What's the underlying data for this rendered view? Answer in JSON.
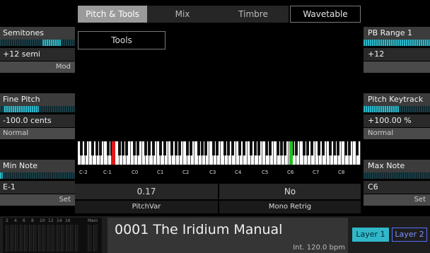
{
  "tabs": [
    {
      "label": "Pitch & Tools",
      "active": true
    },
    {
      "label": "Mix",
      "active": false
    },
    {
      "label": "Timbre",
      "active": false
    },
    {
      "label": "Wavetable",
      "active": false
    }
  ],
  "tools": {
    "label": "Tools"
  },
  "left": {
    "semitones": {
      "header": "Semitones",
      "value": "+12 semi",
      "mode": "Mod",
      "level": 0.8
    },
    "fine_pitch": {
      "header": "Fine Pitch",
      "value": "-100.0 cents",
      "mode": "Normal",
      "level": 0.5
    },
    "min_note": {
      "header": "Min Note",
      "value": "E-1",
      "mode": "Set",
      "level": 0.05
    }
  },
  "right": {
    "pb_range": {
      "header": "PB Range 1",
      "value": "+12",
      "level": 1.0
    },
    "pitch_keytrack": {
      "header": "Pitch Keytrack",
      "value": "+100.00 %",
      "mode": "Normal",
      "level": 0.5
    },
    "max_note": {
      "header": "Max Note",
      "value": "C6",
      "mode": "Set",
      "level": 0.0
    }
  },
  "keyboard": {
    "octave_labels": [
      "C-2",
      "C-1",
      "C0",
      "C1",
      "C2",
      "C3",
      "C4",
      "C5",
      "C6",
      "C7",
      "C8"
    ],
    "low_marker_color": "#e01818",
    "high_marker_color": "#21c221"
  },
  "controls": {
    "pitch_var": {
      "value": "0.17",
      "label": "PitchVar"
    },
    "mono_retrig": {
      "value": "No",
      "label": "Mono Retrig"
    }
  },
  "mixer": {
    "scale": [
      "2",
      "4",
      "6",
      "8",
      "10",
      "12",
      "14",
      "16"
    ],
    "main_label": "Main"
  },
  "preset": {
    "name": "0001 The Iridium Manual",
    "tempo": "Int. 120.0 bpm"
  },
  "layers": [
    {
      "label": "Layer 1",
      "active": true,
      "color": "#31b7c9"
    },
    {
      "label": "Layer 2",
      "active": false,
      "color": "#5570ff"
    }
  ]
}
